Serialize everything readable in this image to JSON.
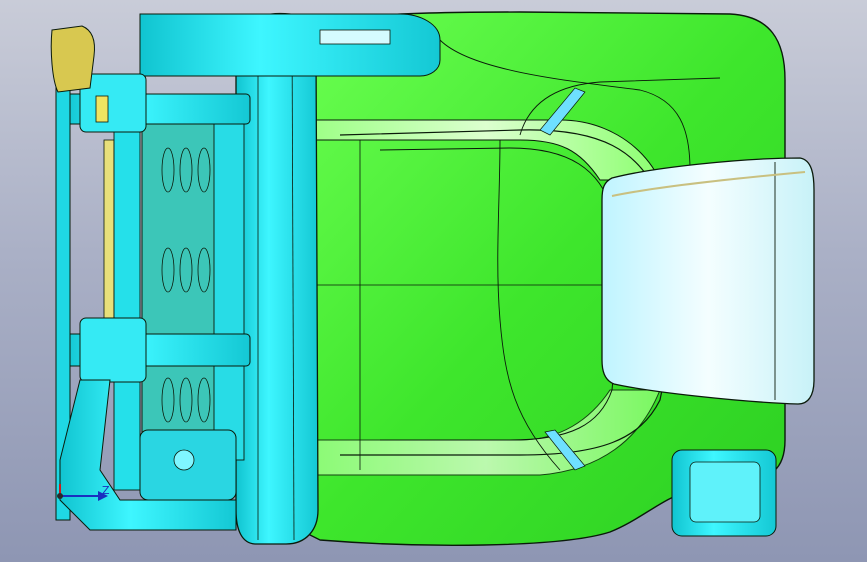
{
  "viewport": {
    "background_top": "#c9ccd8",
    "background_bottom": "#8e96b3"
  },
  "colors": {
    "cushion_green": "#4ef03a",
    "cushion_highlight": "#d9ffcc",
    "frame_cyan": "#1fe6f0",
    "frame_cyan_dark": "#12b8c4",
    "panel_light": "#e8fbff",
    "part_yellow": "#e6e070",
    "edge_black": "#101820",
    "axis_blue": "#1a2fbf",
    "axis_red": "#d01818"
  },
  "triad": {
    "axis_label": "Z",
    "icon": "coordinate-triad-icon"
  }
}
